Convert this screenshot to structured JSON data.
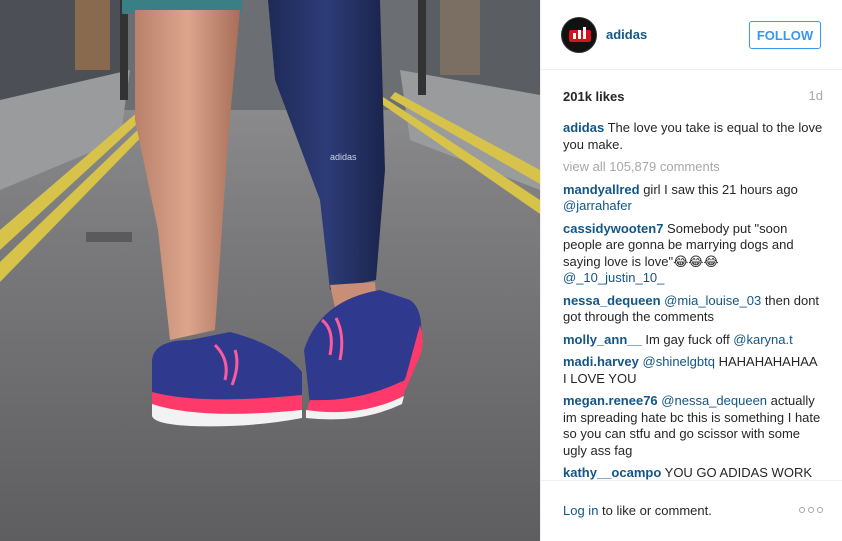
{
  "post": {
    "username": "adidas",
    "follow_label": "FOLLOW",
    "likes": "201k likes",
    "age": "1d",
    "caption_user": "adidas",
    "caption_text": " The love you take is equal to the love you make.",
    "view_all": "view all 105,879 comments",
    "login_link": "Log in",
    "login_rest": " to like or comment."
  },
  "comments": [
    {
      "user": "mandyallred",
      "text": " girl I saw this 21 hours ago ",
      "mention": "@jarrahafer",
      "tail": ""
    },
    {
      "user": "cassidywooten7",
      "text": " Somebody put \"soon people are gonna be marrying dogs and saying love is love\"😂😂😂 ",
      "mention": "@_10_justin_10_",
      "tail": ""
    },
    {
      "user": "nessa_dequeen",
      "text": " ",
      "mention": "@mia_louise_03",
      "tail": " then dont got through the comments"
    },
    {
      "user": "molly_ann__",
      "text": " Im gay fuck off ",
      "mention": "@karyna.t",
      "tail": ""
    },
    {
      "user": "madi.harvey",
      "text": " ",
      "mention": "@shinelgbtq",
      "tail": " HAHAHAHAHAA I LOVE YOU"
    },
    {
      "user": "megan.renee76",
      "text": " ",
      "mention": "@nessa_dequeen",
      "tail": " actually im spreading hate bc this is something I hate so you can stfu and go scissor with some ugly ass fag"
    },
    {
      "user": "kathy__ocampo",
      "text": " YOU GO ADIDAS WORK",
      "mention": "",
      "tail": ""
    }
  ],
  "colors": {
    "link_blue": "#125688",
    "follow_blue": "#3897f0",
    "muted_gray": "#a5a7aa",
    "brand_red": "#d3141c"
  },
  "icons": {
    "more": "more-options-icon",
    "avatar": "adidas-logo-icon"
  }
}
